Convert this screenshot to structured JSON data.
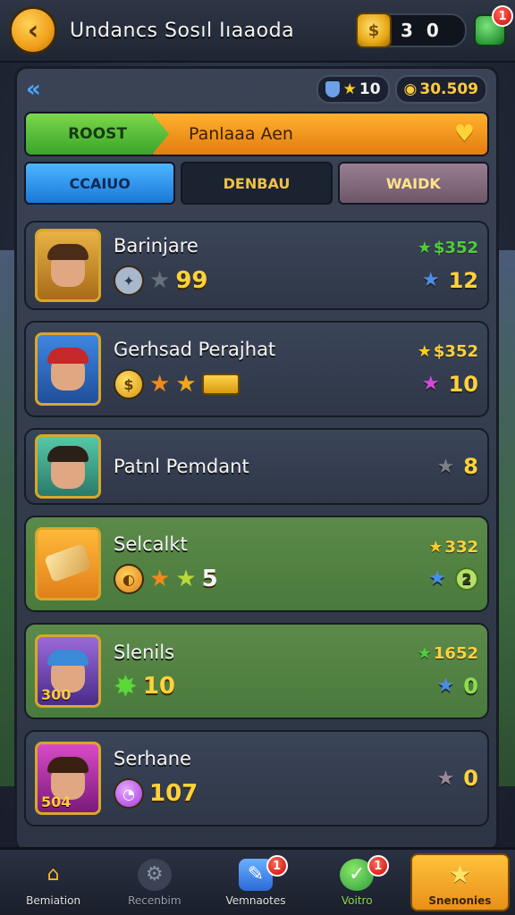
{
  "header": {
    "title": "Undancs  Sosıl Iıaaoda",
    "coins": "3 0",
    "gem_badge": "1"
  },
  "panel": {
    "stars_value": "10",
    "gold_value": "30.509",
    "banner": {
      "left_label": "ROOST",
      "right_label": "Panlaaa Aen"
    },
    "tabs": [
      {
        "label": "CCAIUO"
      },
      {
        "label": "DENBAU"
      },
      {
        "label": "WAIDK"
      }
    ],
    "rows": [
      {
        "name": "Barinjare",
        "stat_value": "99",
        "side_top": "$352",
        "side_bottom": "12",
        "avatar_badge": ""
      },
      {
        "name": "Gerhsad Perajhat",
        "stat_value": "",
        "side_top": "$352",
        "side_bottom": "10",
        "avatar_badge": ""
      },
      {
        "name": "Patnl Pemdant",
        "stat_value": "",
        "side_top": "",
        "side_bottom": "8",
        "avatar_badge": ""
      },
      {
        "name": "Selcalkt",
        "stat_value": "5",
        "side_top": "332",
        "side_bottom": "2",
        "avatar_badge": ""
      },
      {
        "name": "Slenils",
        "stat_value": "10",
        "side_top": "1652",
        "side_bottom": "0",
        "avatar_badge": "300"
      },
      {
        "name": "Serhane",
        "stat_value": "107",
        "side_top": "",
        "side_bottom": "0",
        "avatar_badge": "504"
      }
    ]
  },
  "nav": [
    {
      "label": "Bemiation",
      "badge": ""
    },
    {
      "label": "Recenbim",
      "badge": ""
    },
    {
      "label": "Vemnaotes",
      "badge": "1"
    },
    {
      "label": "Voitro",
      "badge": "1"
    },
    {
      "label": "Snenonies",
      "badge": ""
    }
  ],
  "colors": {
    "accent_gold": "#ffc23a",
    "tab_blue": "#1a78d8",
    "banner_green": "#3aa42a",
    "banner_orange": "#e37c10",
    "row_green": "#4a7a3c"
  }
}
